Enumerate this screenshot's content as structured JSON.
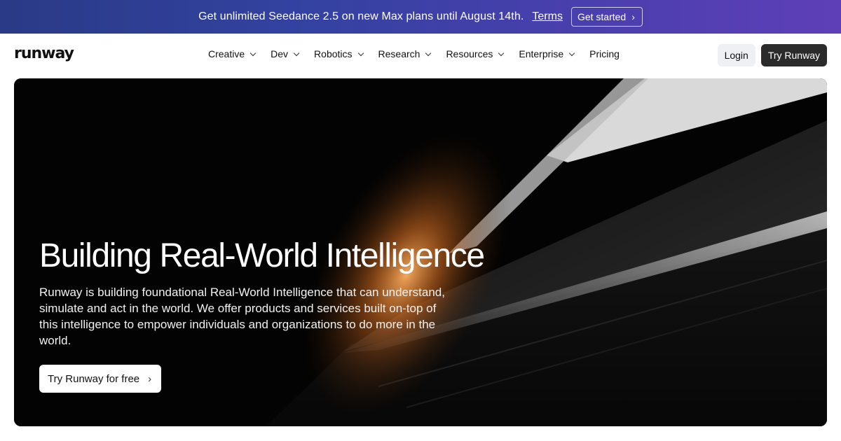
{
  "banner": {
    "message": "Get unlimited Seedance 2.5 on new Max plans until August 14th.",
    "terms_link": "Terms",
    "cta_label": "Get started",
    "cta_icon": "chevron-right-icon",
    "colors": {
      "gradient_start": "#2a3a86",
      "gradient_end": "#5e3fb8"
    }
  },
  "header": {
    "logo": "runway",
    "menu": [
      {
        "label": "Creative",
        "has_dropdown": true
      },
      {
        "label": "Dev",
        "has_dropdown": true
      },
      {
        "label": "Robotics",
        "has_dropdown": true
      },
      {
        "label": "Research",
        "has_dropdown": true
      },
      {
        "label": "Resources",
        "has_dropdown": true
      },
      {
        "label": "Enterprise",
        "has_dropdown": true
      },
      {
        "label": "Pricing",
        "has_dropdown": false
      }
    ],
    "login_label": "Login",
    "try_label": "Try Runway"
  },
  "hero": {
    "title": "Building Real-World Intelligence",
    "description": "Runway is building foundational Real-World Intelligence that can understand, simulate and act in the world. We offer products and services built on-top of this intelligence to empower individuals and organizations to do more in the world.",
    "cta_label": "Try Runway for free",
    "cta_icon": "chevron-right-icon"
  }
}
